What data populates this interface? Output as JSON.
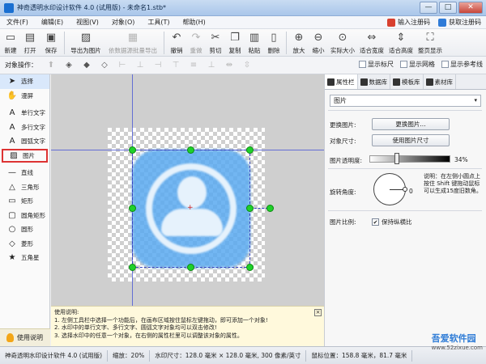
{
  "window": {
    "title": "神奇透明水印设计软件 4.0 (试用版) - 未命名1.stb*",
    "min_label": "—",
    "max_label": "□",
    "close_label": "✕"
  },
  "menu": {
    "items": [
      "文件(F)",
      "编辑(E)",
      "视图(V)",
      "对象(O)",
      "工具(T)",
      "帮助(H)"
    ],
    "register_label": "输入注册码",
    "get_register_label": "获取注册码"
  },
  "toolbar": {
    "buttons": [
      {
        "label": "新建",
        "icon": "new-file-icon",
        "glyph": "▭"
      },
      {
        "label": "打开",
        "icon": "open-folder-icon",
        "glyph": "▤"
      },
      {
        "label": "保存",
        "icon": "save-icon",
        "glyph": "▣"
      },
      {
        "label": "导出为图片",
        "icon": "export-image-icon",
        "glyph": "▨"
      },
      {
        "label": "依数据源批量导出",
        "icon": "batch-export-icon",
        "glyph": "▦"
      },
      {
        "label": "撤销",
        "icon": "undo-icon",
        "glyph": "↶"
      },
      {
        "label": "重做",
        "icon": "redo-icon",
        "glyph": "↷"
      },
      {
        "label": "剪切",
        "icon": "cut-icon",
        "glyph": "✂"
      },
      {
        "label": "复制",
        "icon": "copy-icon",
        "glyph": "❐"
      },
      {
        "label": "粘贴",
        "icon": "paste-icon",
        "glyph": "▥"
      },
      {
        "label": "删除",
        "icon": "delete-icon",
        "glyph": "▯"
      },
      {
        "label": "放大",
        "icon": "zoom-in-icon",
        "glyph": "⊕"
      },
      {
        "label": "缩小",
        "icon": "zoom-out-icon",
        "glyph": "⊖"
      },
      {
        "label": "实际大小",
        "icon": "actual-size-icon",
        "glyph": "⊙"
      },
      {
        "label": "适合宽度",
        "icon": "fit-width-icon",
        "glyph": "⇔"
      },
      {
        "label": "适合高度",
        "icon": "fit-height-icon",
        "glyph": "⇕"
      },
      {
        "label": "整页显示",
        "icon": "full-page-icon",
        "glyph": "⛶"
      }
    ]
  },
  "objbar": {
    "label": "对象操作：",
    "show_ruler": "显示标尺",
    "show_grid": "显示网格",
    "show_guides": "显示参考线"
  },
  "tools": {
    "items": [
      {
        "label": "选择",
        "icon": "pointer-icon",
        "glyph": "➤"
      },
      {
        "label": "漫屏",
        "icon": "hand-icon",
        "glyph": "✋"
      },
      {
        "label": "单行文字",
        "icon": "single-line-text-icon",
        "glyph": "A"
      },
      {
        "label": "多行文字",
        "icon": "multi-line-text-icon",
        "glyph": "A"
      },
      {
        "label": "圆弧文字",
        "icon": "arc-text-icon",
        "glyph": "A"
      },
      {
        "label": "图片",
        "icon": "image-icon",
        "glyph": "▨"
      },
      {
        "label": "直线",
        "icon": "line-icon",
        "glyph": "—"
      },
      {
        "label": "三角形",
        "icon": "triangle-icon",
        "glyph": "△"
      },
      {
        "label": "矩形",
        "icon": "rectangle-icon",
        "glyph": "▭"
      },
      {
        "label": "圆角矩形",
        "icon": "rounded-rect-icon",
        "glyph": "▢"
      },
      {
        "label": "圆形",
        "icon": "circle-icon",
        "glyph": "○"
      },
      {
        "label": "菱形",
        "icon": "diamond-icon",
        "glyph": "◇"
      },
      {
        "label": "五角星",
        "icon": "star-icon",
        "glyph": "★"
      }
    ],
    "help_label": "使用说明"
  },
  "help_note": {
    "title": "使用说明:",
    "line1": "1. 左侧工具栏中选择一个功能后，在画布区域按住鼠标左键拖动，即可添加一个对象!",
    "line2": "2. 水印中的单行文字、多行文字、圆弧文字对象均可以双击修改!",
    "line3": "3. 选择水印中的任意一个对象，在右侧的属性栏里可以调整该对象的属性。",
    "close_label": "×"
  },
  "right_panel": {
    "tabs": [
      "属性栏",
      "数据库",
      "模板库",
      "素材库"
    ],
    "object_type": "图片",
    "replace_image_label": "更换图片:",
    "replace_image_button": "更换图片...",
    "object_size_label": "对象尺寸:",
    "use_image_size_button": "使用图片尺寸",
    "opacity_label": "图片透明度:",
    "opacity_value": "34%",
    "opacity_fraction": 0.34,
    "rotation_label": "旋转角度:",
    "rotation_value": "0",
    "rotation_note": "说明：在左侧小圆点上按住 Shift 键拖动鼠标可以生成15度旧数角。",
    "ratio_label": "图片比例:",
    "keep_ratio_label": "保持纵横比",
    "keep_ratio_checked": "✔"
  },
  "status": {
    "app": "神奇透明水印设计软件 4.0 (试用版)",
    "zoom": "缩放：20%",
    "watermark_size": "水印尺寸：128.0 毫米 × 128.0 毫米, 300 像素/英寸",
    "mouse_pos": "鼠标位置：158.8 毫米，81.7 毫米"
  },
  "site_watermark": {
    "name": "吾爱软件园",
    "url": "www.52zixue.com"
  },
  "colors": {
    "accent": "#1a6fd1",
    "handle": "#1fd12a",
    "guide": "#3545d6"
  }
}
